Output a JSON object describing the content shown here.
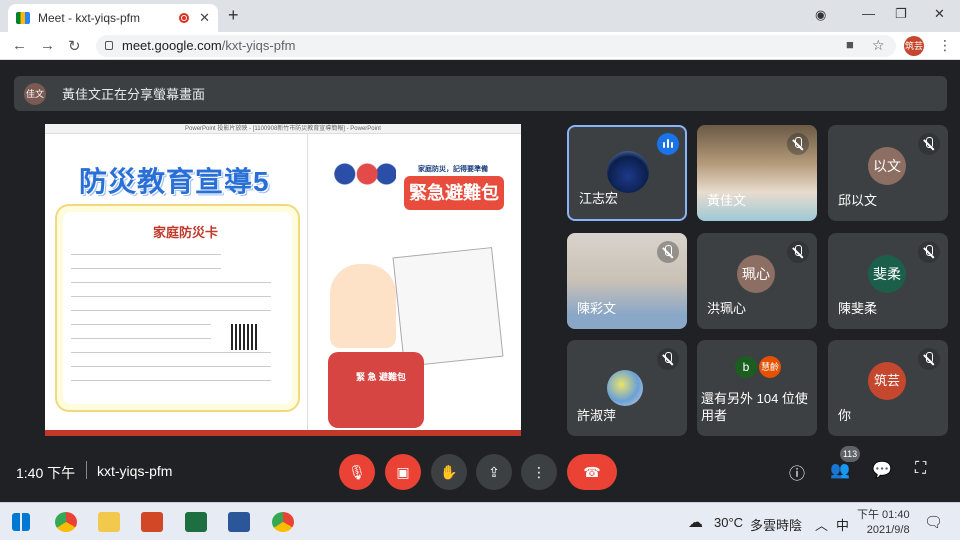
{
  "browser": {
    "tab_title": "Meet - kxt-yiqs-pfm",
    "url_host": "meet.google.com",
    "url_path": "/kxt-yiqs-pfm",
    "profile_initials": "筑芸"
  },
  "banner": {
    "avatar": "佳文",
    "text": "黃佳文正在分享螢幕畫面"
  },
  "presentation": {
    "window_title": "PowerPoint 投影片放映 - [1100908新竹市防災教育宣導簡報] - PowerPoint",
    "left_title": "防災教育宣導5",
    "card_title": "家庭防災卡",
    "right_subtitle": "家庭防災，記得要準備",
    "right_title": "緊急避難包",
    "bag_label": "緊 急 避難包"
  },
  "participants": [
    {
      "name": "江志宏",
      "initials": "",
      "muted": false,
      "speaking": true
    },
    {
      "name": "黃佳文",
      "initials": "",
      "muted": true,
      "speaking": false
    },
    {
      "name": "邱以文",
      "initials": "以文",
      "muted": true,
      "color": "#8d6e63"
    },
    {
      "name": "陳彩文",
      "initials": "",
      "muted": true
    },
    {
      "name": "洪珮心",
      "initials": "珮心",
      "muted": true,
      "color": "#8d6e63"
    },
    {
      "name": "陳斐柔",
      "initials": "斐柔",
      "muted": true,
      "color": "#1b5e4a"
    },
    {
      "name": "許淑萍",
      "initials": "",
      "muted": true
    },
    {
      "name": "還有另外 104 位使用者",
      "initials_a": "b",
      "initials_b": "慧齡"
    },
    {
      "name": "你",
      "initials": "筑芸",
      "muted": true,
      "color": "#c5472d"
    }
  ],
  "meeting": {
    "time": "1:40 下午",
    "code": "kxt-yiqs-pfm",
    "people_count": "113"
  },
  "taskbar": {
    "temperature": "30°C",
    "weather": "多雲時陰",
    "ime": "中",
    "clock_time": "下午 01:40",
    "clock_date": "2021/9/8"
  }
}
